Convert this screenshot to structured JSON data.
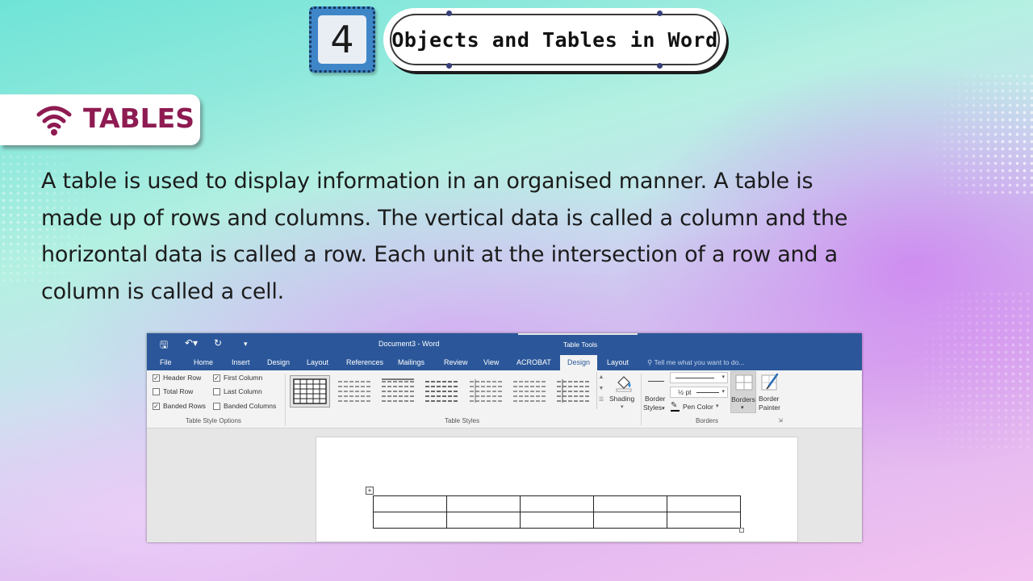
{
  "header": {
    "chapter_number": "4",
    "chapter_title": "Objects and Tables in Word"
  },
  "section": {
    "icon": "wifi-icon",
    "title": "TABLES"
  },
  "paragraph": {
    "line1": "A table is used to display information in an organised manner. A table is",
    "line2": "made up of rows and columns. The vertical data is called a column and the",
    "line3": "horizontal data is called a row. Each unit at the intersection of a row and a",
    "line4": "column is called a cell."
  },
  "word_window": {
    "title": "Document3 - Word",
    "contextual_group": "Table Tools",
    "tabs": [
      "File",
      "Home",
      "Insert",
      "Design",
      "Layout",
      "References",
      "Mailings",
      "Review",
      "View",
      "ACROBAT",
      "Design",
      "Layout"
    ],
    "active_tab": "Design",
    "tell_me": "Tell me what you want to do...",
    "style_options": {
      "header_row": "Header Row",
      "total_row": "Total Row",
      "banded_rows": "Banded Rows",
      "first_column": "First Column",
      "last_column": "Last Column",
      "banded_columns": "Banded Columns",
      "checked": {
        "header_row": true,
        "total_row": false,
        "banded_rows": true,
        "first_column": true,
        "last_column": false,
        "banded_columns": false
      },
      "group_label": "Table Style Options"
    },
    "table_styles": {
      "group_label": "Table Styles",
      "thumbnail_count": 7
    },
    "shading_label": "Shading",
    "borders": {
      "border_styles_1": "Border",
      "border_styles_2": "Styles",
      "weight": "½ pt",
      "pen_color": "Pen Color",
      "borders_btn": "Borders",
      "painter_1": "Border",
      "painter_2": "Painter",
      "group_label": "Borders"
    },
    "document_table": {
      "rows": 2,
      "cols": 5
    }
  },
  "colors": {
    "accent_maroon": "#8e1b52",
    "word_blue": "#2b579a",
    "badge_blue": "#3f86c8"
  }
}
